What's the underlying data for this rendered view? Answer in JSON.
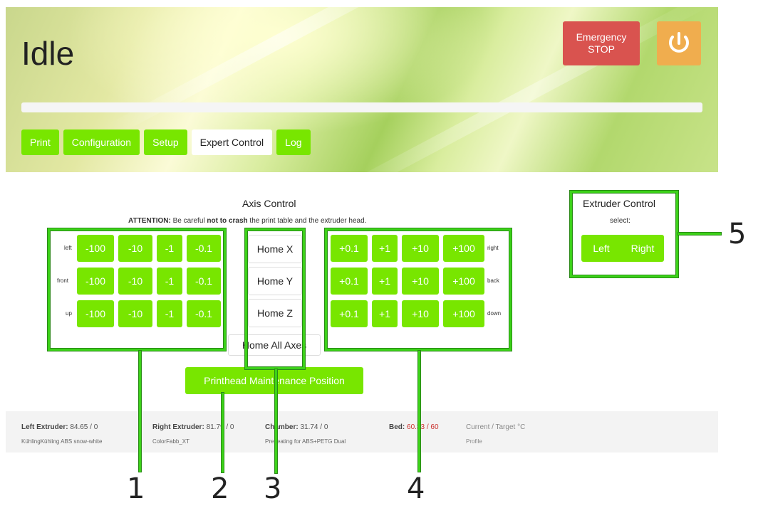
{
  "header": {
    "status_title": "Idle",
    "emergency_stop_label": "Emergency STOP",
    "power_icon": "power-icon",
    "tabs": [
      {
        "label": "Print",
        "active": false
      },
      {
        "label": "Configuration",
        "active": false
      },
      {
        "label": "Setup",
        "active": false
      },
      {
        "label": "Expert Control",
        "active": true
      },
      {
        "label": "Log",
        "active": false
      }
    ]
  },
  "axis_control": {
    "title": "Axis Control",
    "attention_prefix": "ATTENTION:",
    "attention_part1": "Be careful",
    "attention_bold": "not to crash",
    "attention_part2": "the print table and the extruder head.",
    "rows": [
      {
        "left_label": "left",
        "minus": [
          "-100",
          "-10",
          "-1",
          "-0.1"
        ],
        "home": "Home X",
        "plus": [
          "+0.1",
          "+1",
          "+10",
          "+100"
        ],
        "right_label": "right"
      },
      {
        "left_label": "front",
        "minus": [
          "-100",
          "-10",
          "-1",
          "-0.1"
        ],
        "home": "Home Y",
        "plus": [
          "+0.1",
          "+1",
          "+10",
          "+100"
        ],
        "right_label": "back"
      },
      {
        "left_label": "up",
        "minus": [
          "-100",
          "-10",
          "-1",
          "-0.1"
        ],
        "home": "Home Z",
        "plus": [
          "+0.1",
          "+1",
          "+10",
          "+100"
        ],
        "right_label": "down"
      }
    ],
    "home_all": "Home All Axes",
    "maintenance": "Printhead Maintenance Position"
  },
  "extruder_control": {
    "title": "Extruder Control",
    "select_label": "select:",
    "left": "Left",
    "right": "Right"
  },
  "status_bar": {
    "left_extruder_label": "Left Extruder:",
    "left_extruder_value": "84.65 / 0",
    "left_extruder_material": "KühlingKühling ABS snow-white",
    "right_extruder_label": "Right Extruder:",
    "right_extruder_value": "81.79 / 0",
    "right_extruder_material": "ColorFabb_XT",
    "chamber_label": "Chamber:",
    "chamber_value": "31.74 / 0",
    "chamber_note": "Preheating for ABS+PETG Dual",
    "bed_label": "Bed:",
    "bed_current": "60.33",
    "bed_target": "/ 60",
    "legend": "Current / Target °C",
    "profile": "Profile"
  },
  "annotations": [
    "1",
    "2",
    "3",
    "4",
    "5"
  ],
  "colors": {
    "green_button": "#78e600",
    "emergency": "#d9534f",
    "power": "#f0ad4e",
    "annotation": "#3cd219"
  }
}
